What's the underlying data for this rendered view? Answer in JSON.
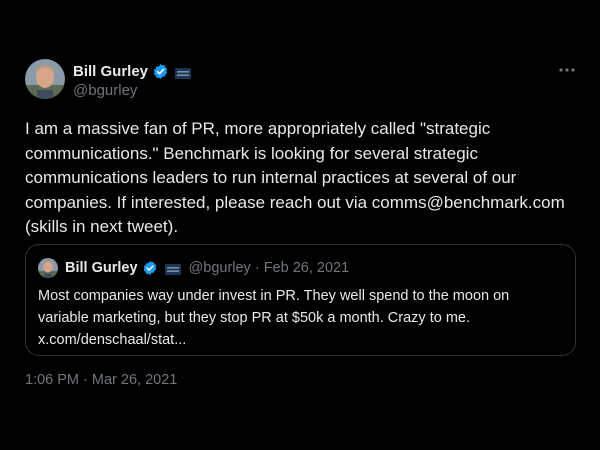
{
  "author": {
    "name": "Bill Gurley",
    "handle": "@bgurley"
  },
  "tweet": {
    "text": "I am a massive fan of PR, more appropriately called \"strategic\ncommunications.\" Benchmark is looking for several strategic\ncommunications leaders to run internal practices at several of our\ncompanies. If interested, please reach out via comms@benchmark.com\n(skills in next tweet).",
    "timestamp": "1:06 PM · Mar 26, 2021"
  },
  "quote": {
    "name": "Bill Gurley",
    "meta": "@bgurley · Feb 26, 2021",
    "text": "Most companies way under invest in PR. They well spend to the moon on\nvariable marketing, but they stop PR at $50k a month. Crazy to me.\nx.com/denschaal/stat..."
  },
  "icons": {
    "verified": "verified-badge-icon",
    "affiliation": "affiliation-flag-icon",
    "more": "more-options-icon"
  },
  "colors": {
    "background": "#000000",
    "text_primary": "#e7e9ea",
    "text_secondary": "#71767b",
    "verified_blue": "#1d9bf0",
    "border": "#2f3336"
  }
}
